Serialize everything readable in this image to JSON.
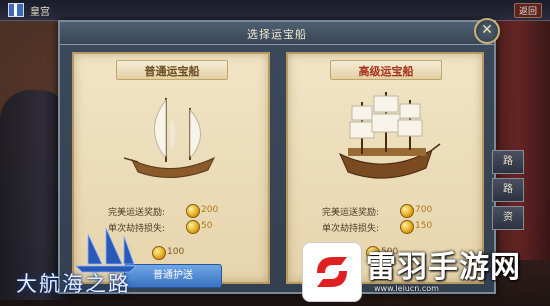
{
  "topbar": {
    "title": "皇宫",
    "right_label": "返回"
  },
  "dialog": {
    "title": "选择运宝船"
  },
  "cards": [
    {
      "title": "普通运宝船",
      "reward_label": "完美运送奖励:",
      "reward_value": "200",
      "loss_label": "单次劫持损失:",
      "loss_value": "50",
      "cost": "100",
      "button": "普通护送"
    },
    {
      "title": "高级运宝船",
      "reward_label": "完美运送奖励:",
      "reward_value": "700",
      "loss_label": "单次劫持损失:",
      "loss_value": "150",
      "cost": "500"
    }
  ],
  "side_buttons": [
    "路",
    "路",
    "资"
  ],
  "game_logo": "大航海之路",
  "watermark": {
    "title": "雷羽手游网",
    "url": "www.leiucn.com"
  },
  "colors": {
    "coin": "#e0a818",
    "button_blue": "#3a72c2",
    "premium_title": "#a6331e"
  }
}
